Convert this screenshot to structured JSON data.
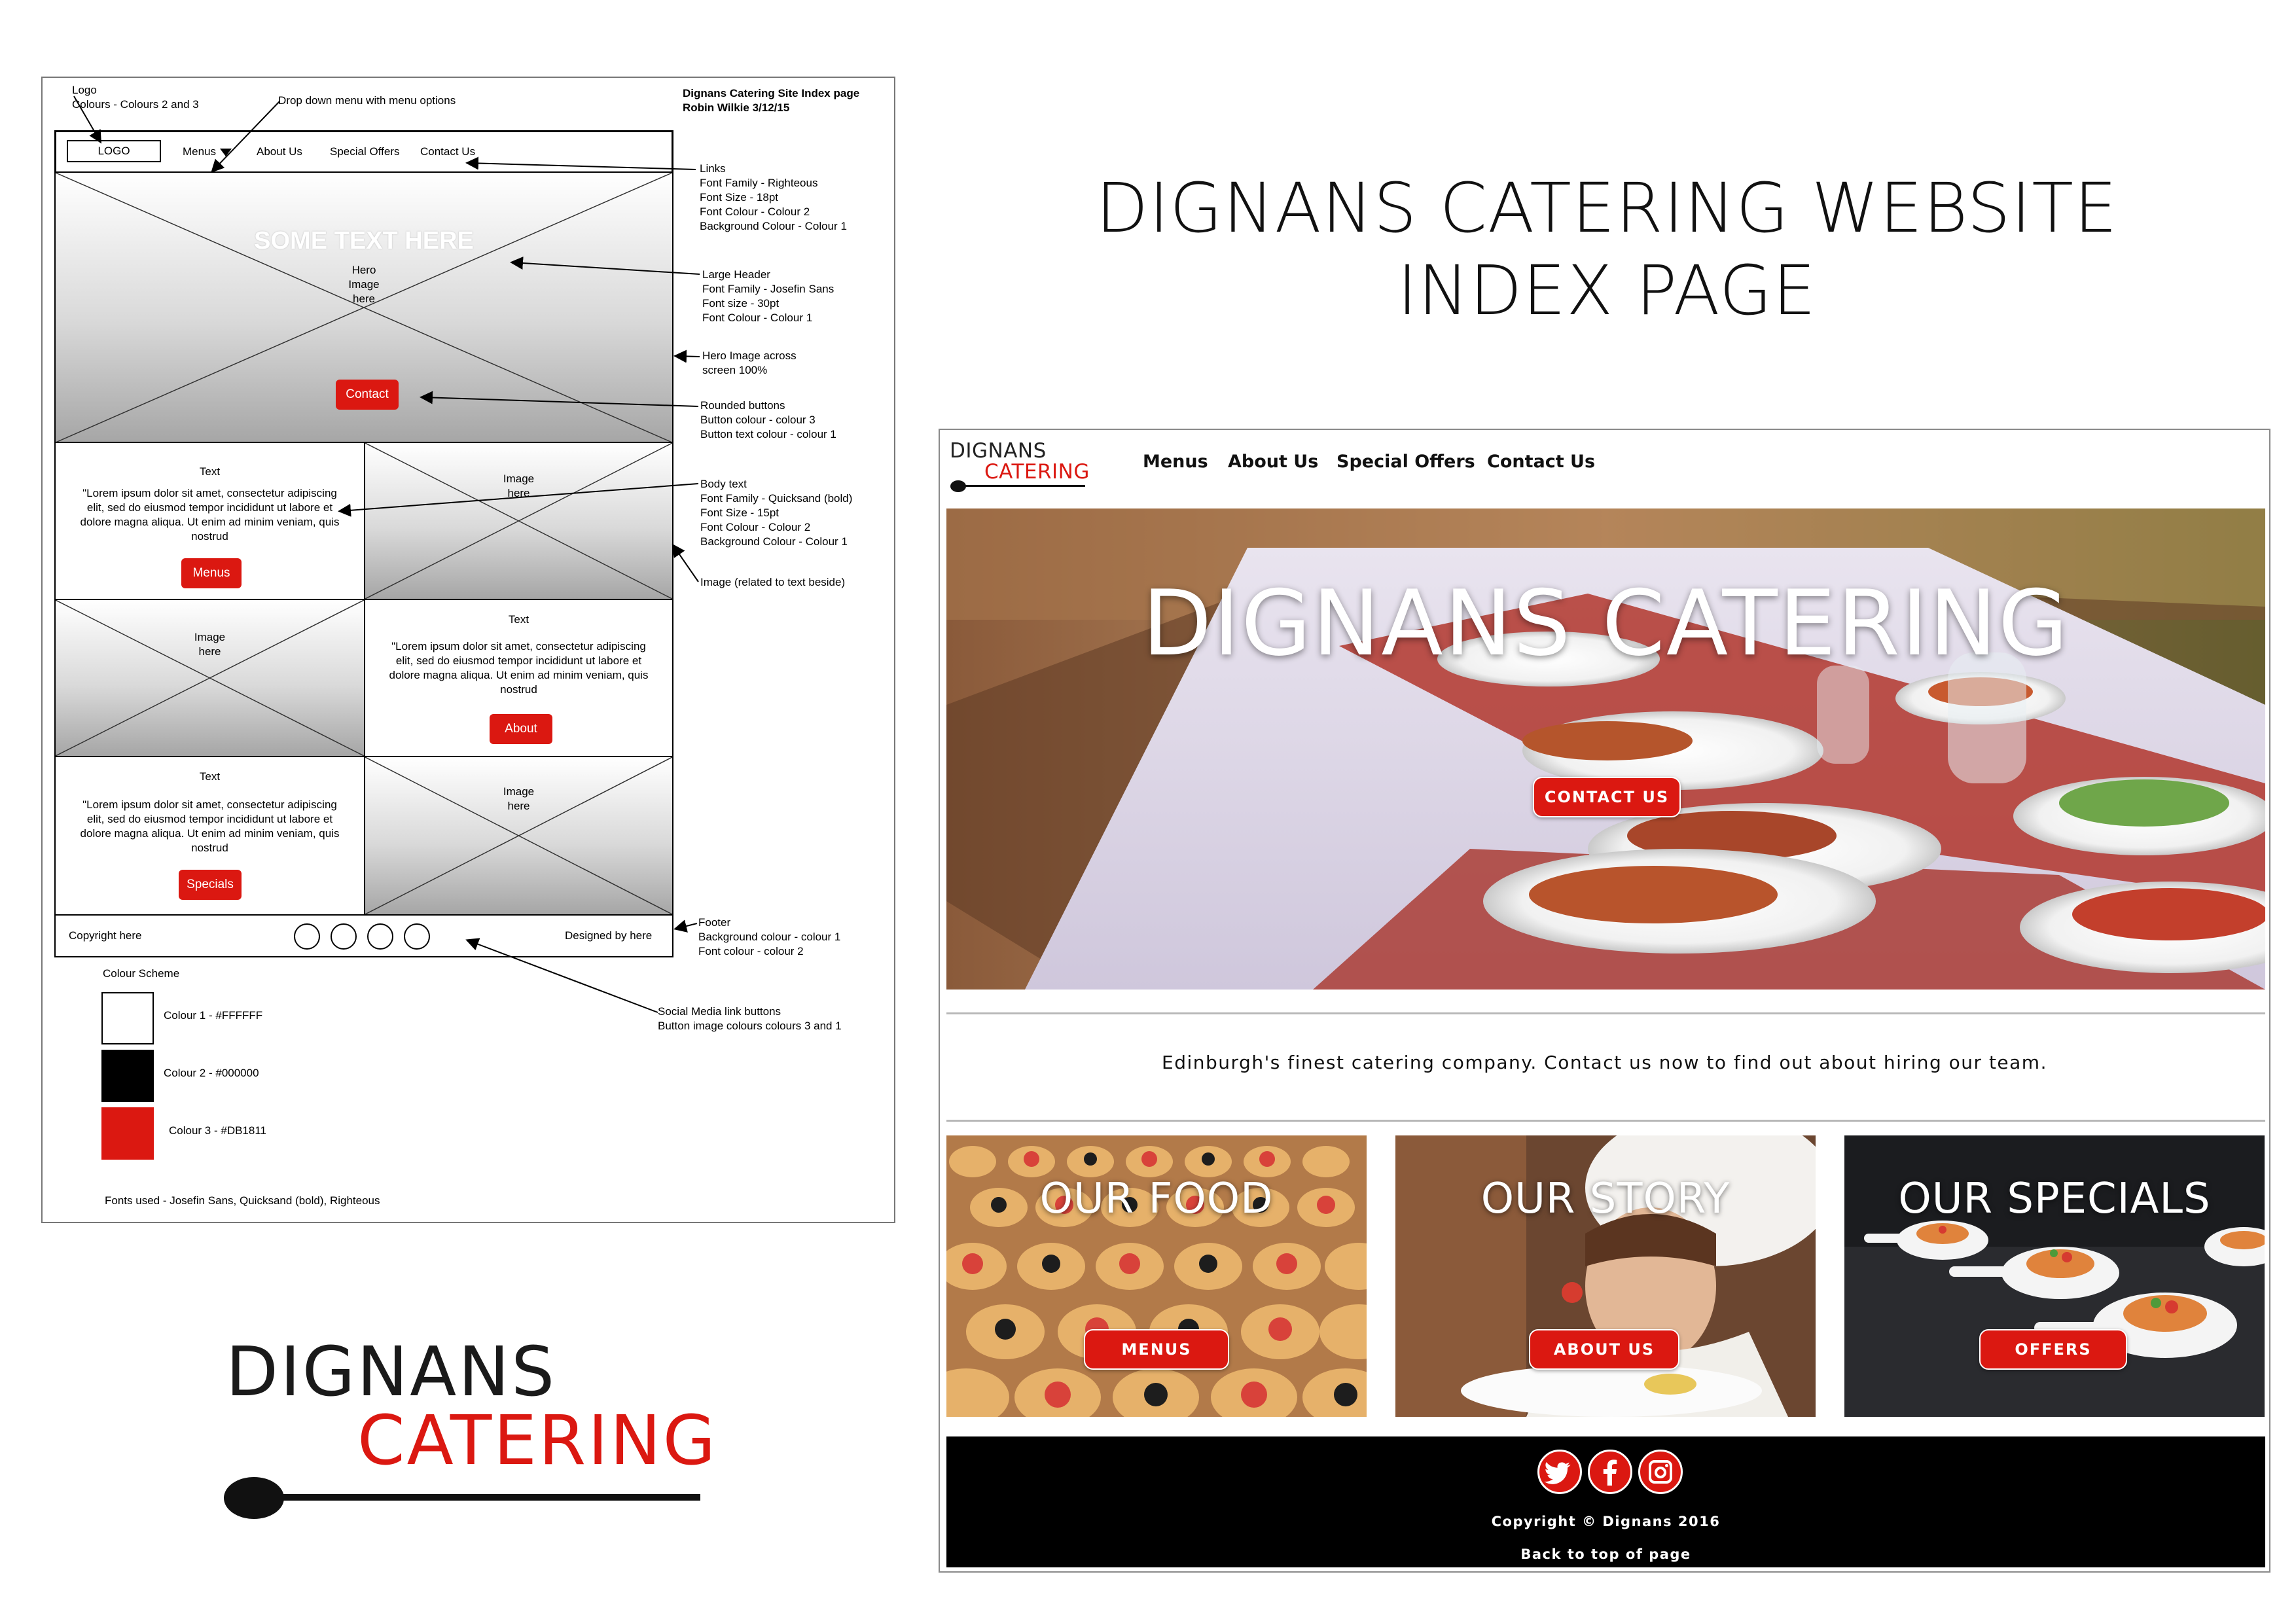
{
  "wireframe": {
    "title_line1": "Dignans Catering Site Index page",
    "title_line2": "Robin Wilkie 3/12/15",
    "nav": {
      "logo": "LOGO",
      "links": [
        "Menus",
        "About Us",
        "Special Offers",
        "Contact Us"
      ]
    },
    "hero": {
      "headline": "SOME TEXT HERE",
      "placeholder": "Hero\nImage\nhere",
      "button": "Contact"
    },
    "sections": [
      {
        "title": "Text",
        "body": "\"Lorem ipsum dolor sit amet, consectetur adipiscing elit, sed do eiusmod tempor incididunt ut labore et dolore magna aliqua. Ut enim ad minim veniam, quis nostrud",
        "button": "Menus",
        "image_label": "Image\nhere"
      },
      {
        "title": "Text",
        "body": "\"Lorem ipsum dolor sit amet, consectetur adipiscing elit, sed do eiusmod tempor incididunt ut labore et dolore magna aliqua. Ut enim ad minim veniam, quis nostrud",
        "button": "About",
        "image_label": "Image\nhere"
      },
      {
        "title": "Text",
        "body": "\"Lorem ipsum dolor sit amet, consectetur adipiscing elit, sed do eiusmod tempor incididunt ut labore et dolore magna aliqua. Ut enim ad minim veniam, quis nostrud",
        "button": "Specials",
        "image_label": "Image\nhere"
      }
    ],
    "footer": {
      "copyright": "Copyright here",
      "designed_by": "Designed by here"
    },
    "colour_scheme": {
      "heading": "Colour Scheme",
      "swatches": [
        {
          "label": "Colour 1 - #FFFFFF",
          "color": "#FFFFFF"
        },
        {
          "label": "Colour 2 - #000000",
          "color": "#000000"
        },
        {
          "label": "Colour 3 - #DB1811",
          "color": "#DB1811"
        }
      ]
    },
    "fonts_used": "Fonts used - Josefin Sans, Quicksand (bold), Righteous",
    "annotations": {
      "logo": "Logo\nColours - Colours 2 and 3",
      "dropdown": "Drop down menu with menu options",
      "links": "Links\nFont Family - Righteous\nFont Size - 18pt\nFont Colour - Colour 2\nBackground Colour - Colour 1",
      "large_header": "Large Header\nFont Family - Josefin Sans\nFont size - 30pt\nFont Colour - Colour 1",
      "hero_image": "Hero Image across\nscreen 100%",
      "rounded_buttons": "Rounded buttons\nButton colour - colour 3\nButton text colour - colour 1",
      "body_text": "Body text\nFont Family - Quicksand (bold)\nFont Size - 15pt\nFont Colour - Colour 2\nBackground Colour - Colour 1",
      "image_related": "Image (related to text beside)",
      "footer": "Footer\nBackground colour - colour 1\nFont colour - colour 2",
      "social": "Social Media link buttons\nButton image colours colours 3 and 1"
    }
  },
  "heading": {
    "line1": "DIGNANS CATERING WEBSITE",
    "line2": "INDEX PAGE"
  },
  "logo": {
    "top": "DIGNANS",
    "bottom": "CATERING"
  },
  "mockup": {
    "logo_top": "DIGNANS",
    "logo_bottom": "CATERING",
    "nav_links": [
      "Menus",
      "About Us",
      "Special Offers",
      "Contact Us"
    ],
    "hero_title": "DIGNANS CATERING",
    "hero_button": "CONTACT US",
    "tagline": "Edinburgh's finest catering company. Contact us now to find out about hiring our team.",
    "tiles": [
      {
        "title": "OUR FOOD",
        "button": "MENUS"
      },
      {
        "title": "OUR STORY",
        "button": "ABOUT US"
      },
      {
        "title": "OUR SPECIALS",
        "button": "OFFERS"
      }
    ],
    "social_icons": [
      "twitter-icon",
      "facebook-icon",
      "instagram-icon"
    ],
    "copyright": "Copyright © Dignans 2016",
    "back_to_top": "Back to top of page",
    "accent_color": "#DB1811"
  }
}
